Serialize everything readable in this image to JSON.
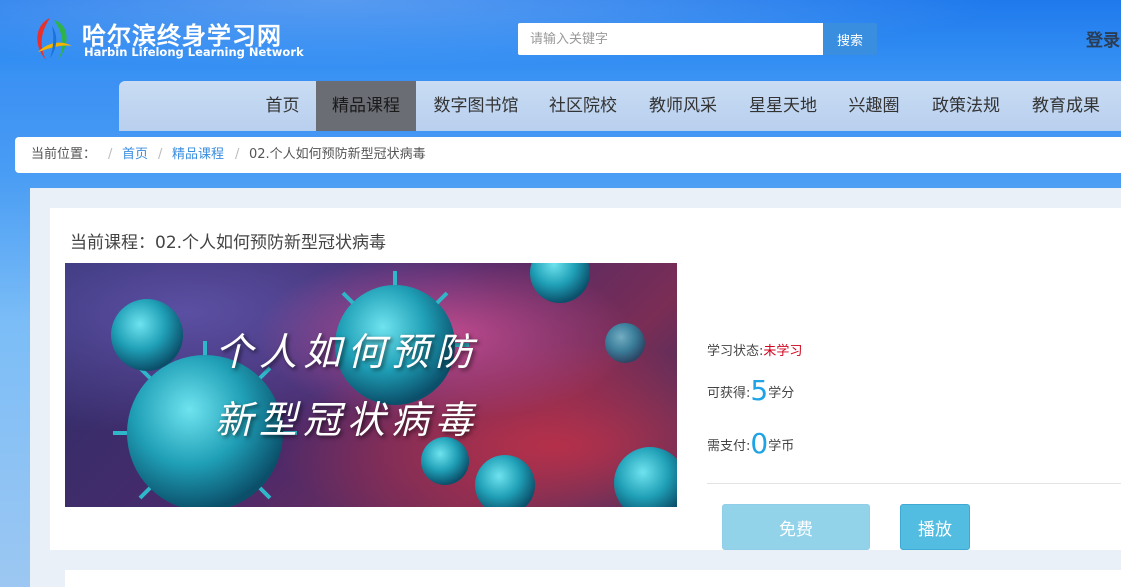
{
  "header": {
    "logo_cn": "哈尔滨终身学习网",
    "logo_en": "Harbin Lifelong Learning Network",
    "search_placeholder": "请输入关键字",
    "search_button": "搜索",
    "login": "登录"
  },
  "nav": {
    "items": [
      {
        "label": "首页"
      },
      {
        "label": "精品课程"
      },
      {
        "label": "数字图书馆"
      },
      {
        "label": "社区院校"
      },
      {
        "label": "教师风采"
      },
      {
        "label": "星星天地"
      },
      {
        "label": "兴趣圈"
      },
      {
        "label": "政策法规"
      },
      {
        "label": "教育成果"
      }
    ],
    "active": "精品课程"
  },
  "breadcrumb": {
    "prefix": "当前位置：",
    "separator": "/",
    "home": "首页",
    "category": "精品课程",
    "current": "02.个人如何预防新型冠状病毒"
  },
  "course": {
    "title": "当前课程：02.个人如何预防新型冠状病毒",
    "cover_line1": "个人如何预防",
    "cover_line2": "新型冠状病毒",
    "status_label": "学习状态:",
    "status_value": "未学习",
    "credits_label": "可获得:",
    "credits_value": "5",
    "credits_unit": "学分",
    "cost_label": "需支付:",
    "cost_value": "0",
    "cost_unit": "学币",
    "free_button": "免费",
    "play_button": "播放"
  },
  "colors": {
    "header_blue": "#2e8af2",
    "nav_bg": "#c9dcf3",
    "nav_active": "#6a6d74",
    "link_blue": "#3a8ee0",
    "status_red": "#d0021b",
    "number_blue": "#1ea3e6",
    "play_button": "#52bde0",
    "free_button": "#92d3ea"
  }
}
